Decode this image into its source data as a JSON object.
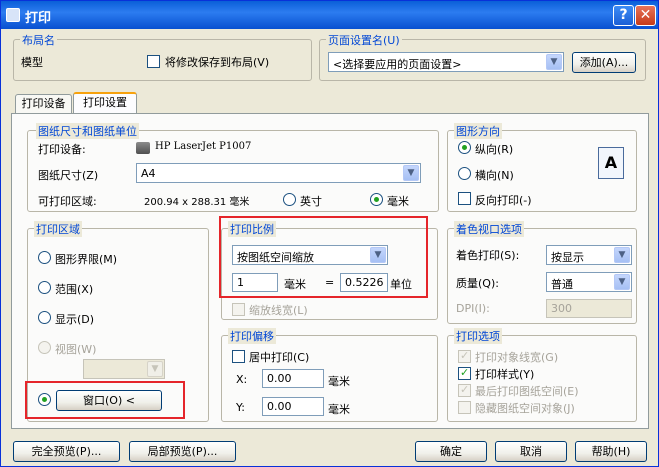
{
  "window": {
    "title": "打印",
    "help_label": "?",
    "close_label": "✕"
  },
  "layout_group": {
    "title": "布局名",
    "name": "模型",
    "save_label": "将修改保存到布局(V)"
  },
  "page_setup_group": {
    "title": "页面设置名(U)",
    "selected": "<选择要应用的页面设置>",
    "add_label": "添加(A)..."
  },
  "tabs": [
    {
      "label": "打印设备"
    },
    {
      "label": "打印设置"
    }
  ],
  "paper_group": {
    "title": "图纸尺寸和图纸单位",
    "device_label": "打印设备:",
    "device_value": "HP LaserJet P1007",
    "size_label": "图纸尺寸(Z)",
    "size_value": "A4",
    "area_label": "可打印区域:",
    "area_value": "200.94 x 288.31 毫米",
    "unit_inch": "英寸",
    "unit_mm": "毫米"
  },
  "orientation_group": {
    "title": "图形方向",
    "portrait": "纵向(R)",
    "landscape": "横向(N)",
    "reverse": "反向打印(-)",
    "preview_letter": "A"
  },
  "area_group": {
    "title": "打印区域",
    "limits": "图形界限(M)",
    "extents": "范围(X)",
    "display": "显示(D)",
    "view": "视图(W)",
    "window_button": "窗口(O) <"
  },
  "scale_group": {
    "title": "打印比例",
    "scale_value": "按图纸空间缩放",
    "left_value": "1",
    "mm_label": "毫米",
    "equals": "=",
    "right_value": "0.5226",
    "unit_label": "单位",
    "lineweight": "缩放线宽(L)"
  },
  "offset_group": {
    "title": "打印偏移",
    "center": "居中打印(C)",
    "x_label": "X:",
    "x_value": "0.00",
    "x_unit": "毫米",
    "y_label": "Y:",
    "y_value": "0.00",
    "y_unit": "毫米"
  },
  "shade_group": {
    "title": "着色视口选项",
    "shade_label": "着色打印(S):",
    "shade_value": "按显示",
    "quality_label": "质量(Q):",
    "quality_value": "普通",
    "dpi_label": "DPI(I):",
    "dpi_value": "300"
  },
  "options_group": {
    "title": "打印选项",
    "lineweights": "打印对象线宽(G)",
    "styles": "打印样式(Y)",
    "paperspace_last": "最后打印图纸空间(E)",
    "hide": "隐藏图纸空间对象(J)"
  },
  "footer": {
    "full_preview": "完全预览(P)...",
    "partial_preview": "局部预览(P)...",
    "ok": "确定",
    "cancel": "取消",
    "help": "帮助(H)"
  }
}
